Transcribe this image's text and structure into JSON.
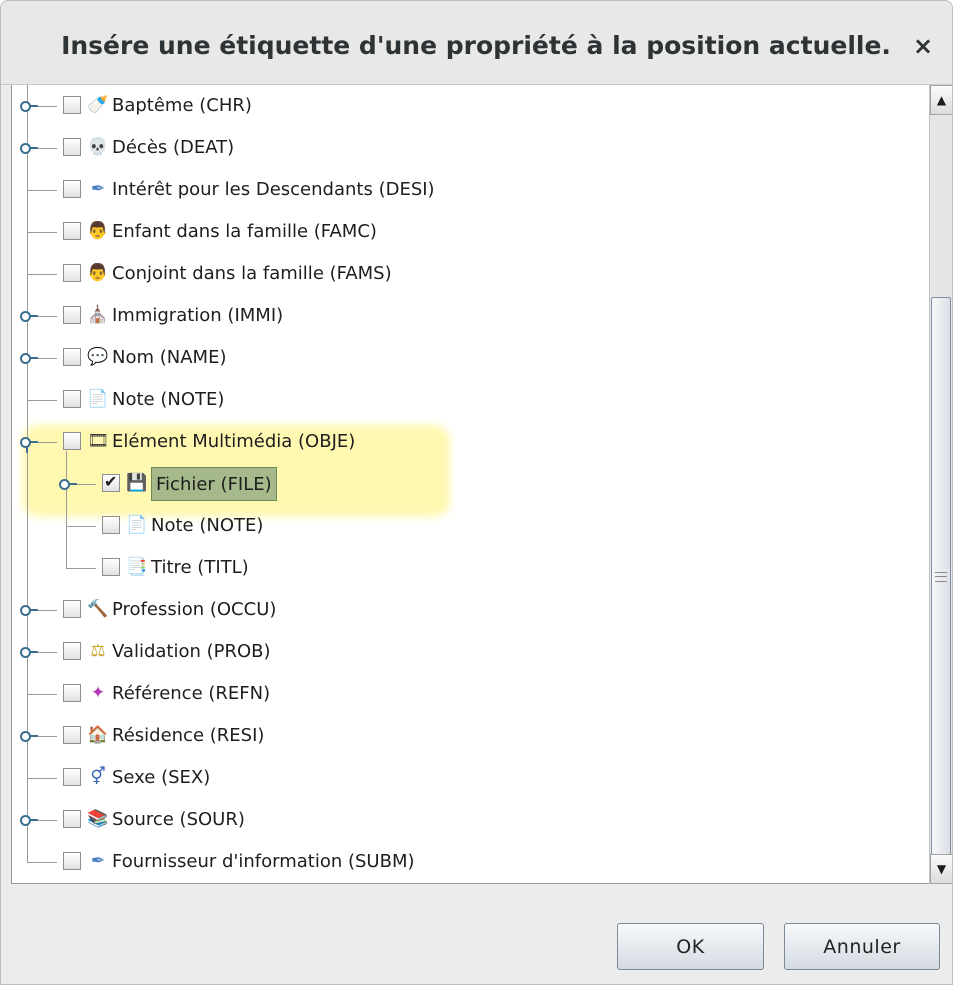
{
  "dialog": {
    "title": "Insére une étiquette d'une propriété à la position actuelle.",
    "close_label": "×"
  },
  "tree": {
    "items": [
      {
        "label": "Baptême (CHR)",
        "icon": "baptism-icon",
        "glyph": "🍼",
        "icon_color": "#7a4b2a",
        "expandable": true,
        "checked": false
      },
      {
        "label": "Décès (DEAT)",
        "icon": "skull-icon",
        "glyph": "💀",
        "icon_color": "#8a6a2a",
        "expandable": true,
        "checked": false
      },
      {
        "label": "Intérêt pour les Descendants (DESI)",
        "icon": "quill-icon",
        "glyph": "✒",
        "icon_color": "#4a7fc0",
        "expandable": false,
        "checked": false
      },
      {
        "label": "Enfant dans la famille (FAMC)",
        "icon": "family-icon",
        "glyph": "👨",
        "icon_color": "#c0392b",
        "expandable": false,
        "checked": false
      },
      {
        "label": "Conjoint dans la famille (FAMS)",
        "icon": "family-icon",
        "glyph": "👨",
        "icon_color": "#c0392b",
        "expandable": false,
        "checked": false
      },
      {
        "label": "Immigration (IMMI)",
        "icon": "building-icon",
        "glyph": "⛪",
        "icon_color": "#c9a224",
        "expandable": true,
        "checked": false
      },
      {
        "label": "Nom (NAME)",
        "icon": "speech-bubble-icon",
        "glyph": "💬",
        "icon_color": "#4caf50",
        "expandable": true,
        "checked": false
      },
      {
        "label": "Note (NOTE)",
        "icon": "note-icon",
        "glyph": "📄",
        "icon_color": "#d59a2a",
        "expandable": false,
        "checked": false
      },
      {
        "label": "Elément Multimédia (OBJE)",
        "icon": "film-icon",
        "glyph": "🎞",
        "icon_color": "#3a3a3a",
        "expandable": true,
        "open": true,
        "checked": false
      },
      {
        "label": "Fichier (FILE)",
        "icon": "floppy-disk-icon",
        "glyph": "💾",
        "icon_color": "#e74c3c",
        "expandable": true,
        "checked": true,
        "selected": true,
        "child": true
      },
      {
        "label": "Note (NOTE)",
        "icon": "note-icon",
        "glyph": "📄",
        "icon_color": "#d59a2a",
        "expandable": false,
        "checked": false,
        "child": true
      },
      {
        "label": "Titre (TITL)",
        "icon": "title-icon",
        "glyph": "📑",
        "icon_color": "#5b8fd0",
        "expandable": false,
        "checked": false,
        "child": true
      },
      {
        "label": "Profession (OCCU)",
        "icon": "hammer-icon",
        "glyph": "🔨",
        "icon_color": "#555555",
        "expandable": true,
        "checked": false
      },
      {
        "label": "Validation (PROB)",
        "icon": "probate-icon",
        "glyph": "⚖",
        "icon_color": "#c9a224",
        "expandable": true,
        "checked": false
      },
      {
        "label": "Référence (REFN)",
        "icon": "puzzle-icon",
        "glyph": "✦",
        "icon_color": "#b03ab5",
        "expandable": false,
        "checked": false
      },
      {
        "label": "Résidence (RESI)",
        "icon": "house-icon",
        "glyph": "🏠",
        "icon_color": "#b0452a",
        "expandable": true,
        "checked": false
      },
      {
        "label": "Sexe (SEX)",
        "icon": "gender-icon",
        "glyph": "⚥",
        "icon_color": "#3566b5",
        "expandable": false,
        "checked": false
      },
      {
        "label": "Source (SOUR)",
        "icon": "book-icon",
        "glyph": "📚",
        "icon_color": "#c46a2a",
        "expandable": true,
        "checked": false
      },
      {
        "label": "Fournisseur d'information (SUBM)",
        "icon": "quill-icon",
        "glyph": "✒",
        "icon_color": "#4a7fc0",
        "expandable": false,
        "checked": false
      }
    ]
  },
  "scrollbar": {
    "up_arrow": "▲",
    "down_arrow": "▼"
  },
  "buttons": {
    "ok_label": "OK",
    "cancel_label": "Annuler"
  },
  "colors": {
    "selection_fill": "#a5b98a",
    "highlight_glow": "#fff7a4",
    "expander_blue": "#3b6e91"
  }
}
